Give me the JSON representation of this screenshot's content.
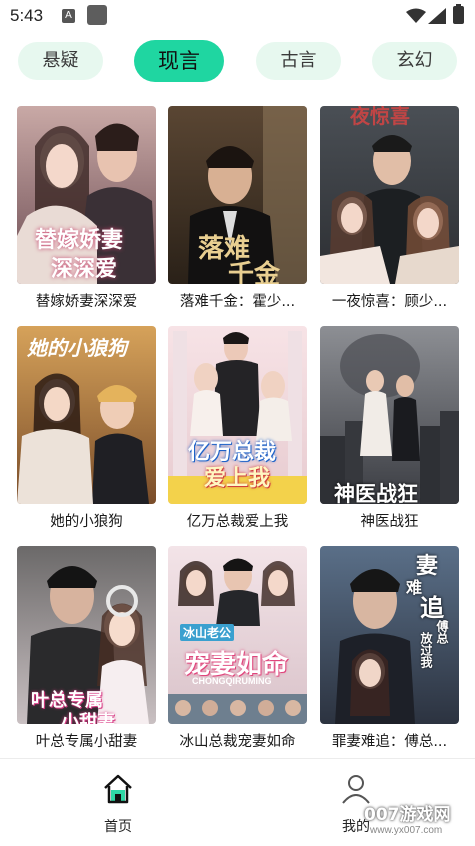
{
  "status_bar": {
    "time": "5:43",
    "notification_badge": "A"
  },
  "tabs": [
    {
      "label": "悬疑",
      "active": false
    },
    {
      "label": "现言",
      "active": true
    },
    {
      "label": "古言",
      "active": false
    },
    {
      "label": "玄幻",
      "active": false
    }
  ],
  "colors": {
    "accent": "#1fd6a1",
    "tab_bg": "#e7f8ef"
  },
  "dramas": [
    {
      "title": "替嫁娇妻深深爱",
      "poster_text": "替嫁娇妻",
      "poster_text2": "深深爱"
    },
    {
      "title": "落难千金：霍少...",
      "poster_text": "落难",
      "poster_text2": "千金"
    },
    {
      "title": "一夜惊喜：顾少...",
      "poster_text": "夜惊喜"
    },
    {
      "title": "她的小狼狗",
      "poster_text": "她的小狼狗"
    },
    {
      "title": "亿万总裁爱上我",
      "poster_text": "亿万总裁",
      "poster_text2": "爱上我"
    },
    {
      "title": "神医战狂",
      "poster_text": "神医战狂"
    },
    {
      "title": "叶总专属小甜妻",
      "poster_text": "叶总专属",
      "poster_text2": "小甜妻"
    },
    {
      "title": "冰山总裁宠妻如命",
      "poster_text": "冰山老公",
      "poster_text2": "宠妻如命",
      "poster_text3": "CHONGQIRUMING"
    },
    {
      "title": "罪妻难追：傅总...",
      "poster_text": "妻",
      "poster_text2": "难",
      "poster_text3": "追",
      "poster_text4": "傅总",
      "poster_text5": "放过我"
    }
  ],
  "bottom_nav": [
    {
      "label": "首页",
      "icon": "home-icon",
      "active": true
    },
    {
      "label": "我的",
      "icon": "person-icon",
      "active": false
    }
  ],
  "watermark": {
    "title": "007游戏网",
    "url": "www.yx007.com"
  }
}
